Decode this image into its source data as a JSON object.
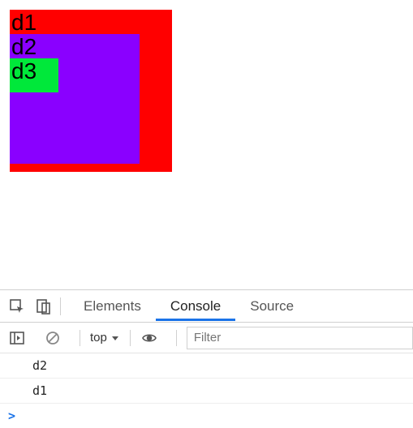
{
  "page": {
    "d1_label": "d1",
    "d2_label": "d2",
    "d3_label": "d3"
  },
  "devtools": {
    "tabs": {
      "elements": "Elements",
      "console": "Console",
      "sources": "Source"
    },
    "toolbar": {
      "context": "top",
      "filter_placeholder": "Filter"
    },
    "console_output": {
      "line0": "d2",
      "line1": "d1"
    },
    "prompt": ">"
  }
}
